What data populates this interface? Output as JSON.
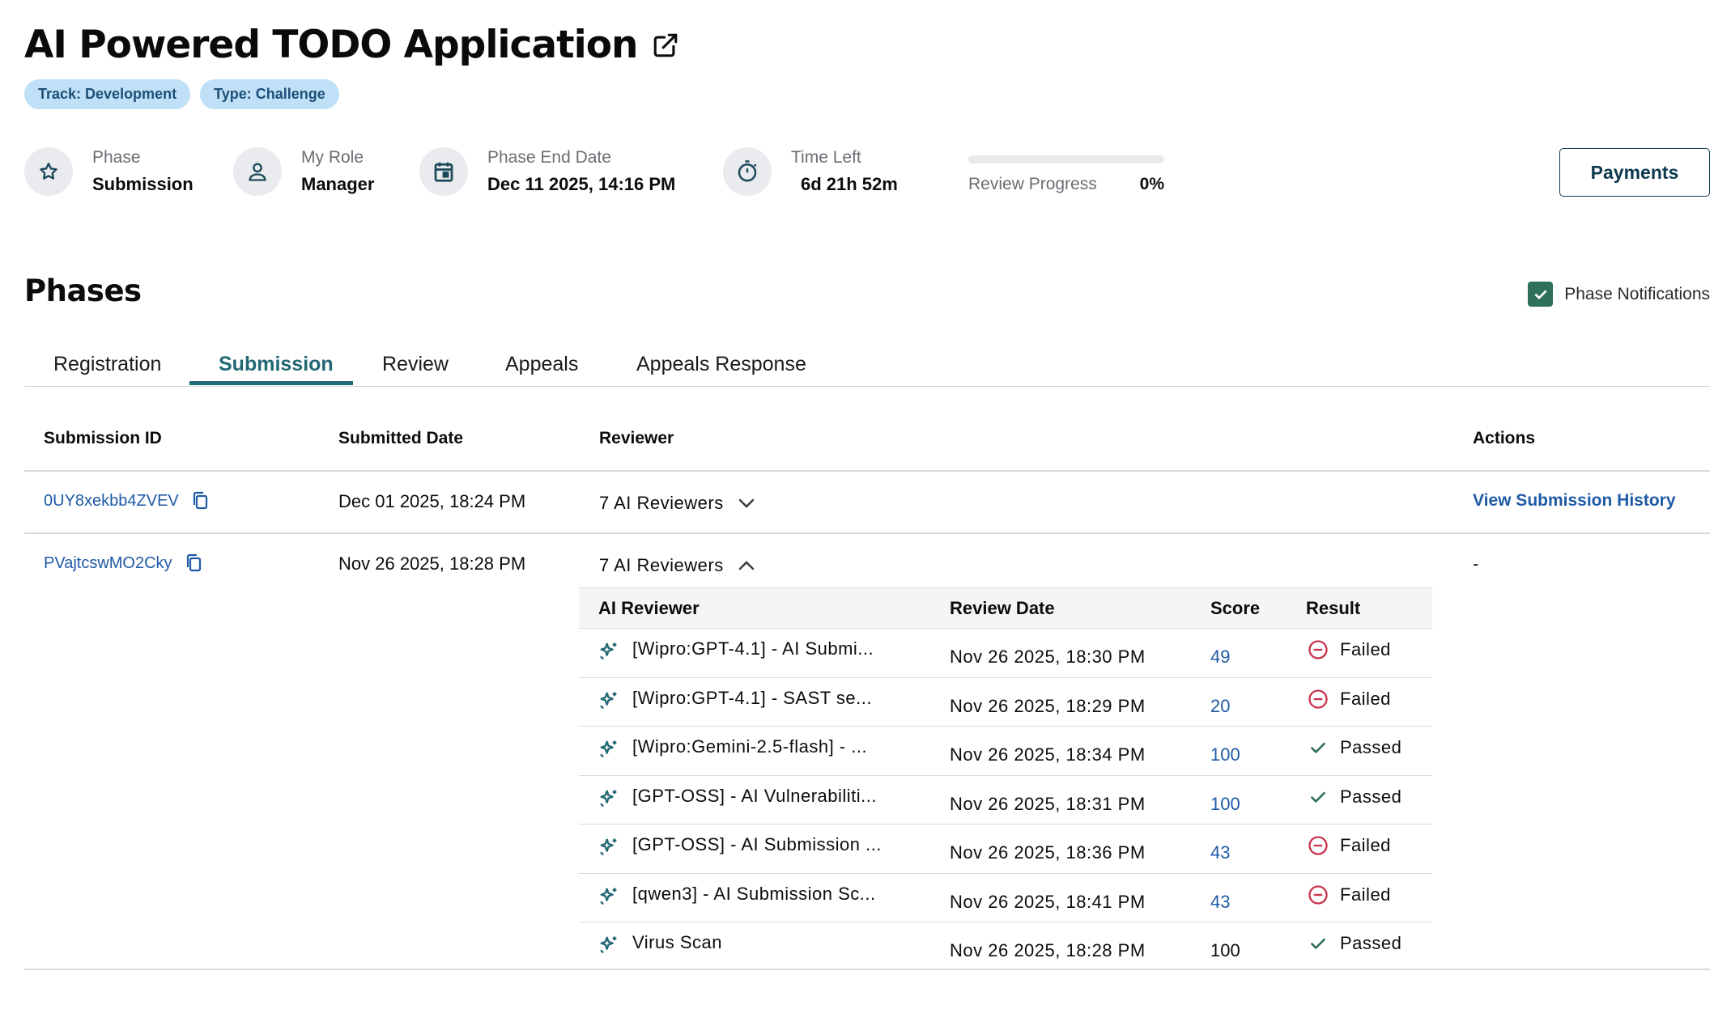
{
  "header": {
    "title": "AI Powered TODO Application",
    "badges": [
      "Track: Development",
      "Type: Challenge"
    ]
  },
  "info": {
    "phase": {
      "label": "Phase",
      "value": "Submission"
    },
    "role": {
      "label": "My Role",
      "value": "Manager"
    },
    "end_date": {
      "label": "Phase End Date",
      "value": "Dec 11 2025, 14:16 PM"
    },
    "time_left": {
      "label": "Time Left",
      "value": "6d 21h 52m"
    },
    "review_progress": {
      "label": "Review Progress",
      "value": "0%",
      "fraction": 0
    }
  },
  "payments_label": "Payments",
  "phases": {
    "title": "Phases",
    "notifications_label": "Phase Notifications",
    "notifications_checked": true,
    "tabs": [
      "Registration",
      "Submission",
      "Review",
      "Appeals",
      "Appeals Response"
    ],
    "active_tab": "Submission"
  },
  "table": {
    "headers": {
      "id": "Submission ID",
      "date": "Submitted Date",
      "reviewer": "Reviewer",
      "actions": "Actions"
    },
    "rows": [
      {
        "id": "0UY8xekbb4ZVEV",
        "date": "Dec 01 2025, 18:24 PM",
        "reviewers": "7 AI Reviewers",
        "action": "View Submission History"
      },
      {
        "id": "PVajtcswMO2Cky",
        "date": "Nov 26 2025, 18:28 PM",
        "reviewers": "7 AI Reviewers",
        "action": "-"
      }
    ]
  },
  "ai_table": {
    "headers": {
      "reviewer": "AI Reviewer",
      "date": "Review Date",
      "score": "Score",
      "result": "Result"
    },
    "rows": [
      {
        "name": "[Wipro:GPT-4.1] - AI Submi...",
        "date": "Nov 26 2025, 18:30 PM",
        "score": "49",
        "result": "Failed"
      },
      {
        "name": "[Wipro:GPT-4.1] - SAST se...",
        "date": "Nov 26 2025, 18:29 PM",
        "score": "20",
        "result": "Failed"
      },
      {
        "name": "[Wipro:Gemini-2.5-flash] - ...",
        "date": "Nov 26 2025, 18:34 PM",
        "score": "100",
        "result": "Passed"
      },
      {
        "name": "[GPT-OSS] - AI Vulnerabiliti...",
        "date": "Nov 26 2025, 18:31 PM",
        "score": "100",
        "result": "Passed"
      },
      {
        "name": "[GPT-OSS] - AI Submission ...",
        "date": "Nov 26 2025, 18:36 PM",
        "score": "43",
        "result": "Failed"
      },
      {
        "name": "[qwen3] - AI Submission Sc...",
        "date": "Nov 26 2025, 18:41 PM",
        "score": "43",
        "result": "Failed"
      },
      {
        "name": "Virus Scan",
        "date": "Nov 26 2025, 18:28 PM",
        "score": "100",
        "result": "Passed"
      }
    ]
  },
  "colors": {
    "accent": "#226873",
    "link": "#1f5aa6",
    "fail": "#c8344b",
    "pass": "#2f7058",
    "badge_bg": "#bfe0f7"
  },
  "icons": [
    "external-link-icon",
    "star-icon",
    "user-icon",
    "calendar-icon",
    "stopwatch-icon",
    "checkbox-check-icon",
    "copy-icon",
    "chevron-down-icon",
    "chevron-up-icon",
    "sparkle-icon",
    "fail-icon",
    "check-icon"
  ]
}
